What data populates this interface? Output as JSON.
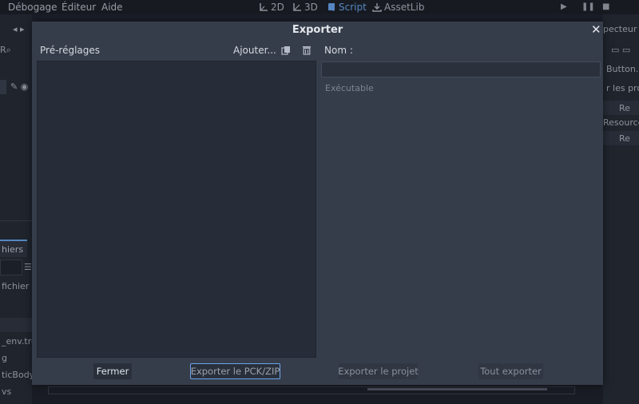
{
  "menubar": {
    "items": [
      "Débogage",
      "Éditeur",
      "Aide"
    ],
    "workspaces": [
      {
        "label": "2D",
        "icon": "2d-icon",
        "active": false
      },
      {
        "label": "3D",
        "icon": "3d-icon",
        "active": false
      },
      {
        "label": "Script",
        "icon": "script-icon",
        "active": true
      },
      {
        "label": "AssetLib",
        "icon": "assetlib-icon",
        "active": false
      }
    ],
    "run_buttons": [
      "play-icon",
      "pause-icon",
      "stop-icon"
    ]
  },
  "background": {
    "left_dock": {
      "tab_label": "hiers",
      "search_placeholder": "fichier",
      "files": [
        "_env.tre",
        "g",
        "ticBody",
        "vs"
      ]
    },
    "right_dock": {
      "title": "pecteur",
      "item_1": "Button.v",
      "filter": "r les pro",
      "res_1": "Re",
      "resource_label": "Resource",
      "res_2": "Re"
    }
  },
  "dialog": {
    "title": "Exporter",
    "presets": {
      "label": "Pré-réglages",
      "add_label": "Ajouter...",
      "items": []
    },
    "name": {
      "label": "Nom :",
      "value": ""
    },
    "executable_label": "Exécutable",
    "buttons": {
      "close": "Fermer",
      "export_pck": "Exporter le PCK/ZIP",
      "export_project": "Exporter le projet",
      "export_all": "Tout exporter"
    }
  },
  "colors": {
    "accent": "#6aa4ec",
    "dialog_bg": "#363d4a",
    "panel_bg": "#272d38"
  }
}
